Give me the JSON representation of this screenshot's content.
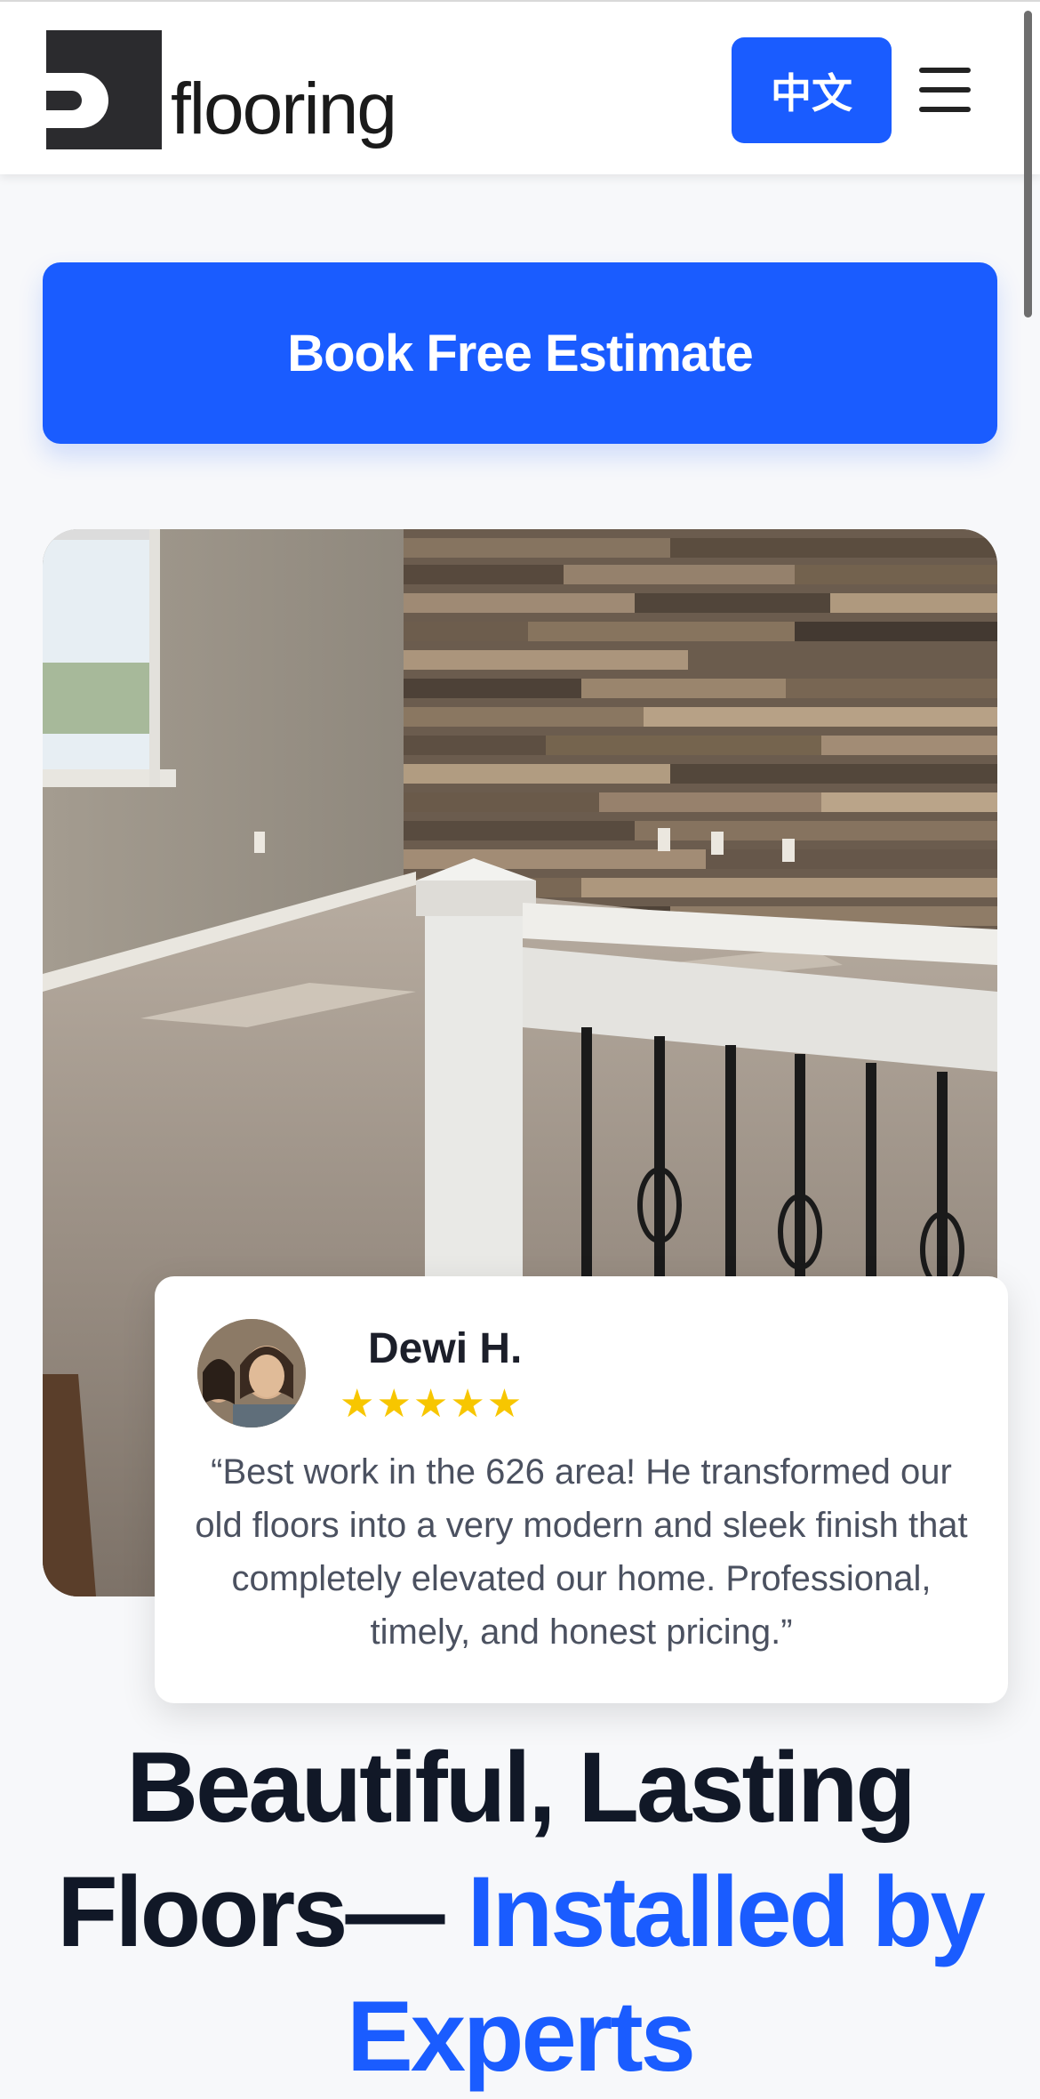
{
  "header": {
    "logo_text": "flooring",
    "language_button": "中文",
    "menu_icon": "hamburger-menu-icon"
  },
  "cta": {
    "label": "Book Free Estimate"
  },
  "hero": {
    "image_description": "room-with-wood-accent-wall-and-railing-photo"
  },
  "review": {
    "name": "Dewi H.",
    "rating": 5,
    "stars": "★★★★★",
    "quote": "“Best work in the 626 area! He transformed our old floors into a very modern and sleek finish that completely elevated our home. Professional, timely, and honest pricing.”"
  },
  "headline": {
    "part1": "Beautiful, Lasting Floors— ",
    "accent": "Installed by Experts"
  },
  "colors": {
    "brand_blue": "#1a5cff",
    "star_yellow": "#f7c600",
    "heading_dark": "#111827"
  }
}
